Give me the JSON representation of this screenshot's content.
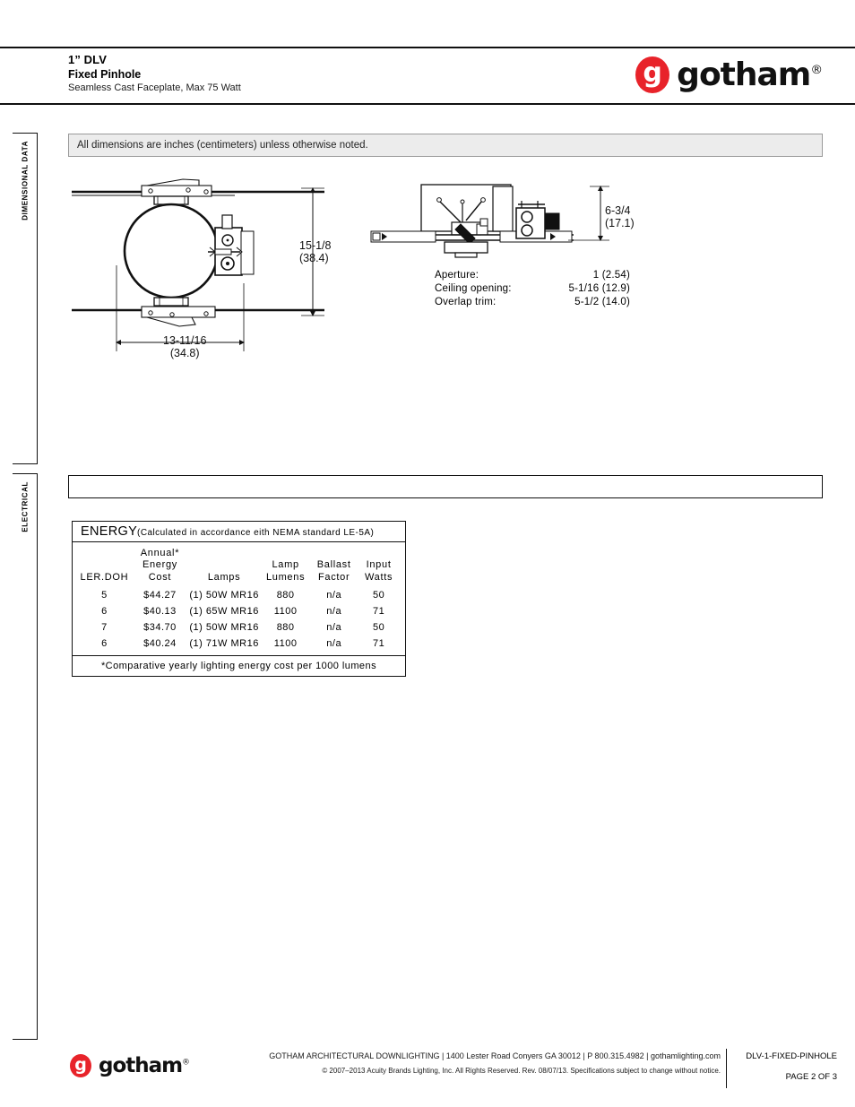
{
  "header": {
    "title": "1” DLV",
    "subtitle": "Fixed Pinhole",
    "description": "Seamless Cast Faceplate, Max 75 Watt",
    "logo_letter": "g",
    "logo_word": "gotham",
    "logo_registered": "®",
    "brand_color": "#e8232a"
  },
  "side_tabs": [
    {
      "label": "DIMENSIONAL  DATA"
    },
    {
      "label": "ELECTRICAL"
    }
  ],
  "notes": {
    "text": "All dimensions are inches (centimeters) unless otherwise noted."
  },
  "drawings": {
    "plan_view": {
      "height_dim": "15-1/8",
      "height_dim_metric": "(38.4)",
      "width_dim": "13-11/16",
      "width_dim_metric": "(34.8)"
    },
    "section_view": {
      "depth_dim": "6-3/4",
      "depth_dim_metric": "(17.1)"
    },
    "specs": [
      {
        "label": "Aperture:",
        "value": "1 (2.54)"
      },
      {
        "label": "Ceiling  opening:",
        "value": "5-1/16 (12.9)"
      },
      {
        "label": "Overlap  trim:",
        "value": "5-1/2 (14.0)"
      }
    ]
  },
  "energy": {
    "title": "ENERGY",
    "title_note": "(Calculated in accordance eith NEMA standard  LE-5A)",
    "columns": [
      "LER.DOH",
      "Annual* Energy Cost",
      "Lamps",
      "Lamp Lumens",
      "Ballast Factor",
      "Input Watts"
    ],
    "column_lines": {
      "ler": [
        "LER.DOH"
      ],
      "cost": [
        "Annual*",
        "Energy",
        "Cost"
      ],
      "lamps": [
        "Lamps"
      ],
      "lumens": [
        "Lamp",
        "Lumens"
      ],
      "ballast": [
        "Ballast",
        "Factor"
      ],
      "watts": [
        "Input",
        "Watts"
      ]
    },
    "rows": [
      {
        "ler": "5",
        "cost": "$44.27",
        "lamps": "(1) 50W MR16",
        "lumens": "880",
        "ballast": "n/a",
        "watts": "50"
      },
      {
        "ler": "6",
        "cost": "$40.13",
        "lamps": "(1) 65W MR16",
        "lumens": "1100",
        "ballast": "n/a",
        "watts": "71"
      },
      {
        "ler": "7",
        "cost": "$34.70",
        "lamps": "(1) 50W MR16",
        "lumens": "880",
        "ballast": "n/a",
        "watts": "50"
      },
      {
        "ler": "6",
        "cost": "$40.24",
        "lamps": "(1) 71W MR16",
        "lumens": "1100",
        "ballast": "n/a",
        "watts": "71"
      }
    ],
    "footnote": "*Comparative yearly lighting energy cost per 1000 lumens"
  },
  "footer": {
    "company_line": "GOTHAM ARCHITECTURAL DOWNLIGHTING  |  1400 Lester Road Conyers GA 30012  |  P 800.315.4982  |  gothamlighting.com",
    "copyright_line": "© 2007–2013 Acuity Brands Lighting, Inc. All Rights Reserved. Rev. 08/07/13. Specifications subject to change without notice.",
    "doc_code": "DLV-1-FIXED-PINHOLE",
    "page_label": "PAGE 2 OF 3"
  }
}
